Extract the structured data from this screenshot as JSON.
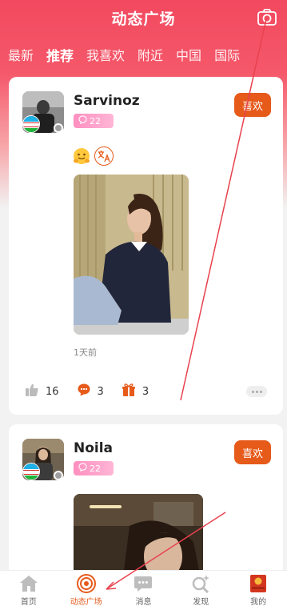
{
  "header": {
    "title": "动态广场"
  },
  "tabs": [
    {
      "label": "最新",
      "active": false
    },
    {
      "label": "推荐",
      "active": true
    },
    {
      "label": "我喜欢",
      "active": false
    },
    {
      "label": "附近",
      "active": false
    },
    {
      "label": "中国",
      "active": false
    },
    {
      "label": "国际",
      "active": false
    }
  ],
  "posts": [
    {
      "username": "Sarvinoz",
      "message_count": "22",
      "like_label": "喜欢",
      "time": "1天前",
      "likes": "16",
      "comments": "3",
      "gifts": "3"
    },
    {
      "username": "Noila",
      "message_count": "22",
      "like_label": "喜欢"
    }
  ],
  "nav": [
    {
      "label": "首页",
      "icon": "home-icon",
      "active": false
    },
    {
      "label": "动态广场",
      "icon": "broadcast-icon",
      "active": true
    },
    {
      "label": "消息",
      "icon": "chat-icon",
      "active": false
    },
    {
      "label": "发现",
      "icon": "discover-icon",
      "active": false
    },
    {
      "label": "我的",
      "icon": "profile-icon",
      "active": false
    }
  ],
  "colors": {
    "brand": "#f2495f",
    "accent": "#e65a1a",
    "badge": "#ff8fc0"
  }
}
